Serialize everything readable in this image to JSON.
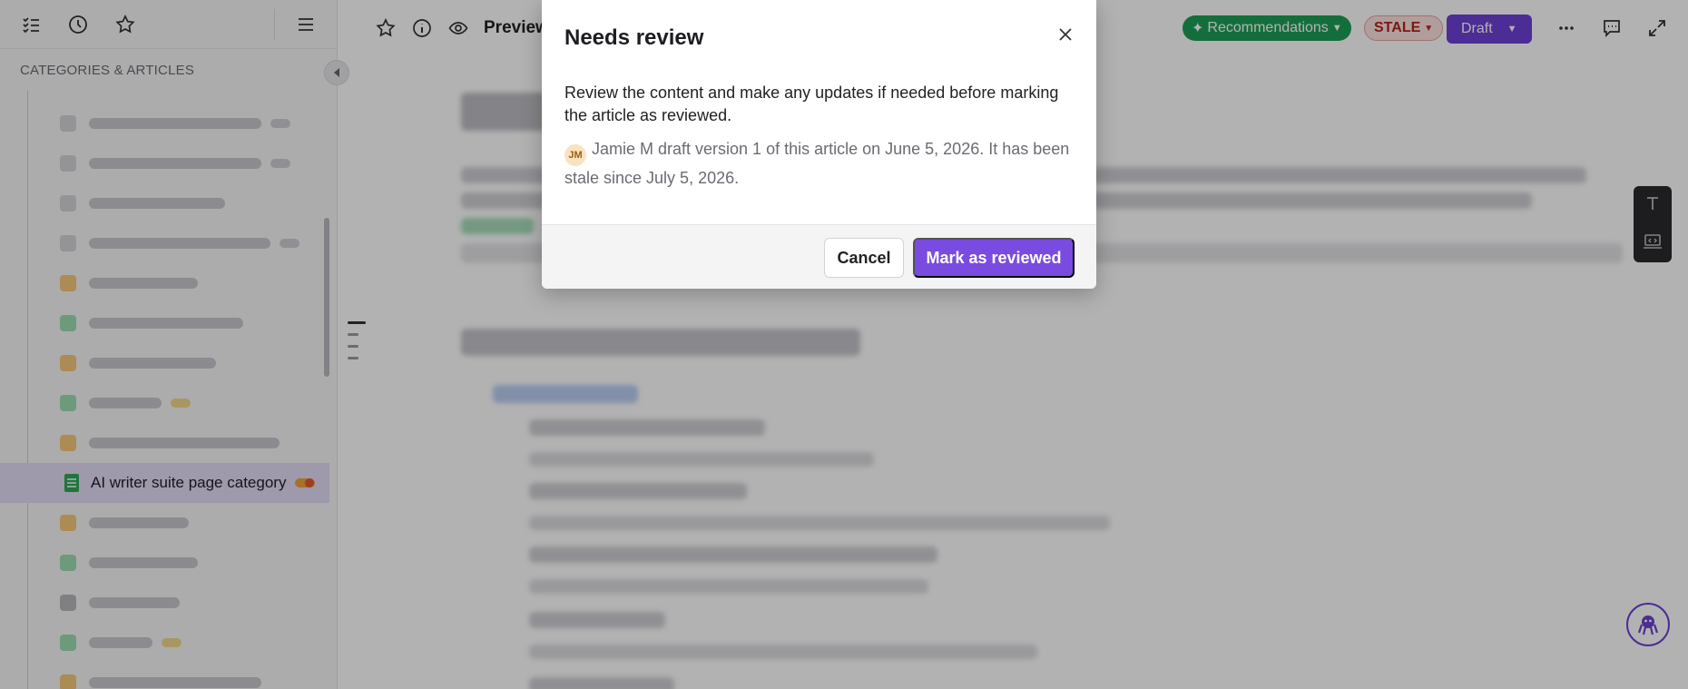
{
  "sidebar": {
    "header": "CATEGORIES & ARTICLES",
    "active_item": {
      "label": "AI writer suite page category"
    }
  },
  "topbar": {
    "preview_label": "Preview",
    "recommendations_label": "Recommendations",
    "stale_label": "STALE",
    "draft_label": "Draft"
  },
  "modal": {
    "title": "Needs review",
    "body": "Review the content and make any updates if needed before marking the article as reviewed.",
    "avatar_initials": "JM",
    "meta": "Jamie M draft version 1 of this article on June 5, 2026. It has been stale since July 5, 2026.",
    "cancel_label": "Cancel",
    "confirm_label": "Mark as reviewed"
  },
  "colors": {
    "accent": "#7a4be0",
    "recommendations": "#1e9e57",
    "stale": "#b42318"
  }
}
